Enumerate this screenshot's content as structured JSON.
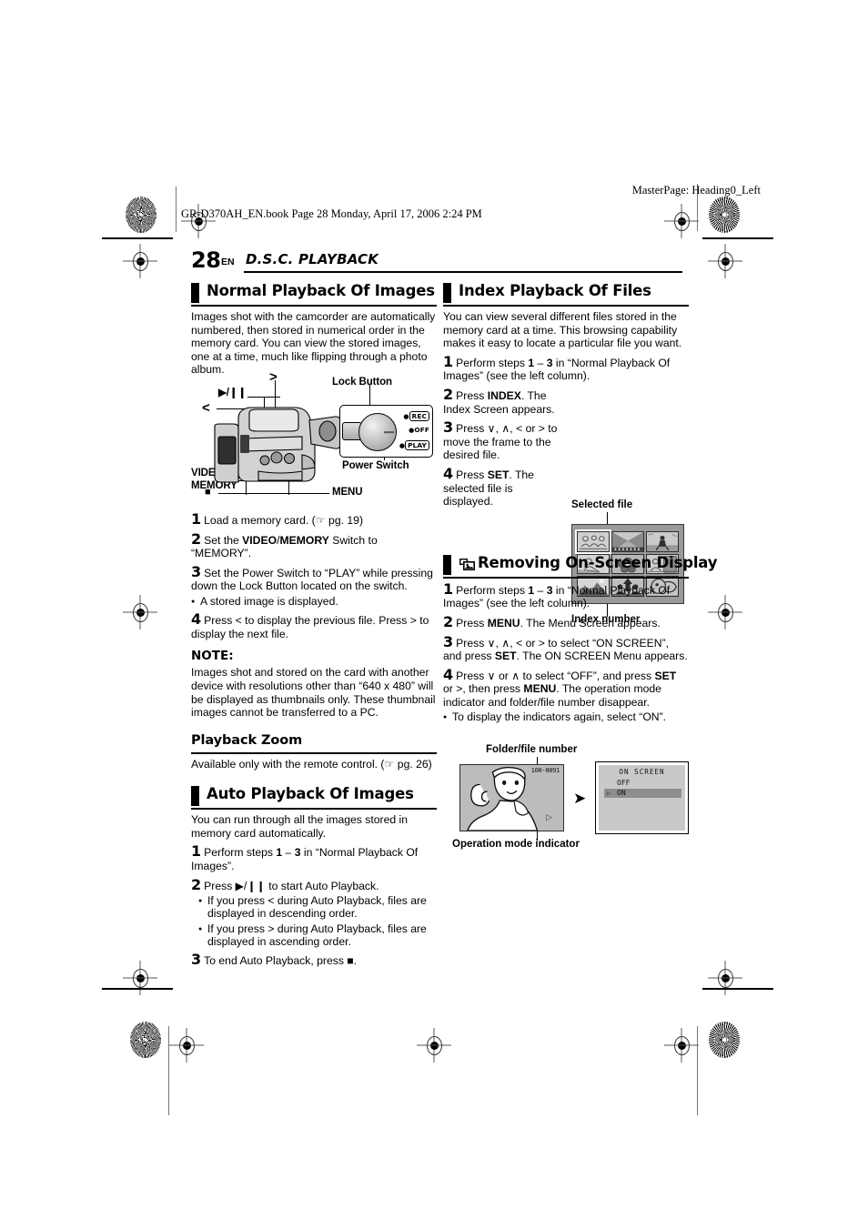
{
  "print": {
    "book_line": "GR-D370AH_EN.book  Page 28  Monday, April 17, 2006  2:24 PM",
    "master_page": "MasterPage: Heading0_Left"
  },
  "running_head": {
    "page_number": "28",
    "lang": "EN",
    "chapter": "D.S.C. PLAYBACK"
  },
  "left_column": {
    "section1": {
      "heading": "Normal Playback Of Images",
      "intro": "Images shot with the camcorder are automatically numbered, then stored in numerical order in the memory card. You can view the stored images, one at a time, much like flipping through a photo album.",
      "figure": {
        "labels": {
          "play_pause": "▶/❙❙",
          "prev": "<",
          "next": ">",
          "stop": "■",
          "video_memory_line1": "VIDEO/",
          "video_memory_line2": "MEMORY",
          "menu": "MENU",
          "lock_button": "Lock Button",
          "power_switch": "Power Switch"
        },
        "power_modes": [
          "REC",
          "OFF",
          "PLAY"
        ]
      },
      "steps": [
        {
          "num": "1",
          "text_html": "Load a memory card. (☞ pg. 19)"
        },
        {
          "num": "2",
          "text_html": "Set the <b>VIDEO</b>/<b>MEMORY</b> Switch to “MEMORY”."
        },
        {
          "num": "3",
          "text_html": "Set the Power Switch to “PLAY” while pressing down the Lock Button located on the switch."
        },
        {
          "num": "4",
          "text_html": "Press &lt; to display the previous file. Press &gt; to display the next file."
        }
      ],
      "step3_bullet": "A stored image is displayed.",
      "note_title": "NOTE:",
      "note_text": "Images shot and stored on the card with another device with resolutions other than “640 x 480” will be displayed as thumbnails only. These thumbnail images cannot be transferred to a PC."
    },
    "section2": {
      "heading": "Playback Zoom",
      "text": "Available only with the remote control. (☞ pg. 26)"
    },
    "section3": {
      "heading": "Auto Playback Of Images",
      "intro": "You can run through all the images stored in memory card automatically.",
      "steps": [
        {
          "num": "1",
          "text_html": "Perform steps <b>1</b> – <b>3</b> in “Normal Playback Of Images”."
        },
        {
          "num": "2",
          "text_html": "Press ▶/❙❙ to start Auto Playback."
        },
        {
          "num": "3",
          "text_html": "To end Auto Playback, press ■."
        }
      ],
      "bullets": [
        "If you press < during Auto Playback, files are displayed in descending order.",
        "If you press > during Auto Playback, files are displayed in ascending order."
      ]
    }
  },
  "right_column": {
    "section1": {
      "heading": "Index Playback Of Files",
      "intro": "You can view several different files stored in the memory card at a time. This browsing capability makes it easy to locate a particular file you want.",
      "steps": [
        {
          "num": "1",
          "text_html": "Perform steps <b>1</b> – <b>3</b> in “Normal Playback Of Images” (see the left column)."
        },
        {
          "num": "2",
          "text_html": "Press <b>INDEX</b>. The Index Screen appears."
        },
        {
          "num": "3",
          "text_html": "Press ∨, ∧, &lt; or &gt; to move the frame to the desired file."
        },
        {
          "num": "4",
          "text_html": "Press <b>SET</b>. The selected file is displayed."
        }
      ],
      "figure": {
        "label_top": "Selected file",
        "label_bottom": "Index number",
        "thumbnail_count": 9,
        "selected_index": 1
      }
    },
    "section2": {
      "heading": "Removing On-Screen Display",
      "icon": "card-stack-icon",
      "steps": [
        {
          "num": "1",
          "text_html": "Perform steps <b>1</b> – <b>3</b> in “Normal Playback Of Images” (see the left column)."
        },
        {
          "num": "2",
          "text_html": "Press <b>MENU</b>. The Menu Screen appears."
        },
        {
          "num": "3",
          "text_html": "Press ∨, ∧, &lt; or &gt; to select “ON SCREEN”, and press <b>SET</b>. The ON SCREEN Menu appears."
        },
        {
          "num": "4",
          "text_html": "Press ∨ or ∧ to select “OFF”, and press <b>SET</b> or &gt;, then press <b>MENU</b>. The operation mode indicator and folder/file number disappear."
        }
      ],
      "bullet": "To display the indicators again, select “ON”.",
      "figure": {
        "label_top": "Folder/file number",
        "label_bottom": "Operation mode indicator",
        "folder_file_number": "100-0091",
        "operation_mode_indicator": "▷",
        "menu": {
          "title": "ON SCREEN",
          "options": [
            "OFF",
            "ON"
          ],
          "selected": "ON",
          "cursor": "▷"
        }
      }
    }
  }
}
